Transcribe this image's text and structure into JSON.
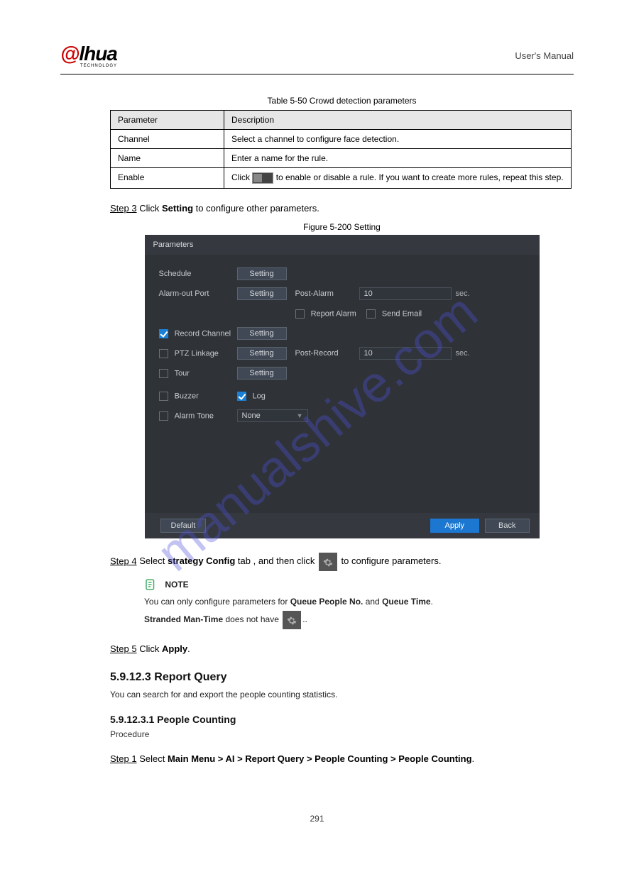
{
  "header": {
    "manual_title": "User's Manual"
  },
  "logo": {
    "sub": "TECHNOLOGY"
  },
  "table": {
    "title": "Table 5-50 Crowd detection parameters",
    "h1": "Parameter",
    "h2": "Description",
    "rows": [
      {
        "p": "Channel",
        "d": "Select a channel to configure face detection."
      },
      {
        "p": "Name",
        "d": "Enter a name for the rule."
      },
      {
        "p": "Enable",
        "d_pre": "Click ",
        "d_post": " to enable or disable a rule. If you want to create more rules, repeat this step."
      }
    ]
  },
  "step3": {
    "label": "Step 3",
    "text_pre": "Click ",
    "text_strong": "Setting",
    "text_post": " to configure other parameters.",
    "fig_title": "Figure 5-200 Setting"
  },
  "screenshot": {
    "title": "Parameters",
    "sched": "Schedule",
    "alarm_out": "Alarm-out Port",
    "post_alarm": "Post-Alarm",
    "post_alarm_val": "10",
    "report": "Report Alarm",
    "send_email": "Send Email",
    "rec_ch": "Record Channel",
    "ptz": "PTZ Linkage",
    "post_rec": "Post-Record",
    "post_rec_val": "10",
    "tour": "Tour",
    "buzzer": "Buzzer",
    "log": "Log",
    "alarm_tone": "Alarm Tone",
    "none": "None",
    "sec": "sec.",
    "setting": "Setting",
    "default": "Default",
    "apply": "Apply",
    "back": "Back"
  },
  "step4": {
    "label": "Step 4",
    "pre": "Select ",
    "strong": "strategy Config",
    "mid": " tab , and then click ",
    "post": " to configure parameters."
  },
  "note": {
    "title": "NOTE",
    "line1_pre": "You can only configure parameters for ",
    "line1_group": "Queue People No.",
    "line1_and": " and ",
    "line1_group2": "Queue Time",
    "line1_post": "",
    "line2_group": "Stranded Man-Time",
    "line2_post": " does not have ",
    "line2_end": "."
  },
  "step5": {
    "label": "Step 5",
    "pre": "Click ",
    "strong": "Apply",
    "post": "."
  },
  "section": {
    "title": "5.9.12.3 Report Query",
    "body": "You can search for and export the people counting statistics.",
    "sub1": "5.9.12.3.1 People Counting",
    "proc": "Procedure"
  },
  "step1": {
    "label": "Step 1",
    "pre": "Select ",
    "path": "Main Menu > AI > Report Query > People Counting > People Counting",
    "post": "."
  },
  "watermark": "manualshive.com",
  "page_no": "291"
}
